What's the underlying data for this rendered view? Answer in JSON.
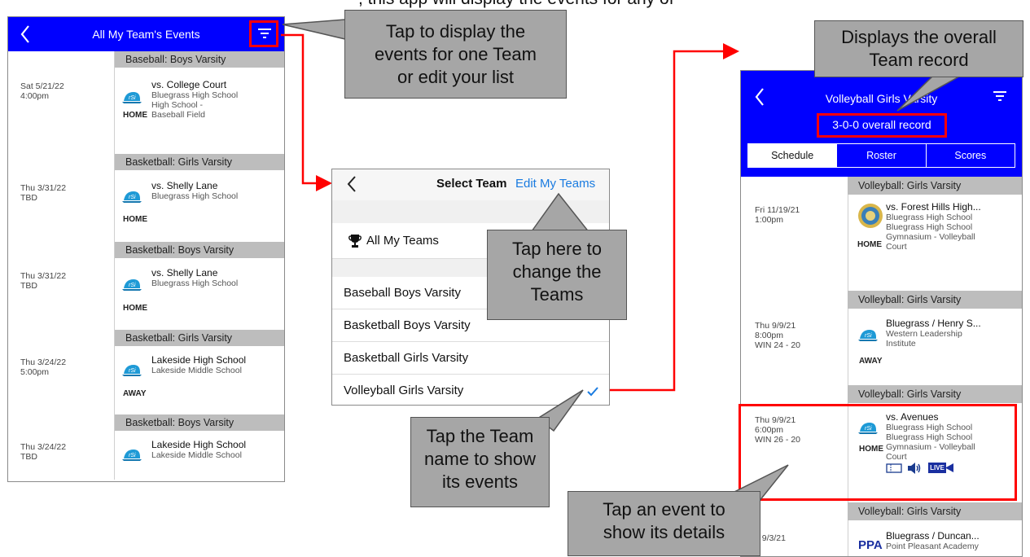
{
  "screen1": {
    "title": "All My Team's Events",
    "events": [
      {
        "section": "Baseball: Boys Varsity",
        "date": "Sat 5/21/22\n4:00pm",
        "opponent": "vs. College Court",
        "details": "Bluegrass High School\nHigh School -\nBaseball Field",
        "location": "HOME"
      },
      {
        "section": "Basketball: Girls Varsity",
        "date": "Thu 3/31/22\nTBD",
        "opponent": "vs. Shelly Lane",
        "details": "Bluegrass High School",
        "location": "HOME"
      },
      {
        "section": "Basketball: Boys Varsity",
        "date": "Thu 3/31/22\nTBD",
        "opponent": "vs. Shelly Lane",
        "details": "Bluegrass High School",
        "location": "HOME"
      },
      {
        "section": "Basketball: Girls Varsity",
        "date": "Thu 3/24/22\n5:00pm",
        "opponent": "Lakeside High School",
        "details": "Lakeside Middle School",
        "location": "AWAY"
      },
      {
        "section": "Basketball: Boys Varsity",
        "date": "Thu 3/24/22\nTBD",
        "opponent": "Lakeside High School",
        "details": "Lakeside Middle School",
        "location": ""
      }
    ]
  },
  "screen2": {
    "title": "Select Team",
    "edit_link": "Edit My Teams",
    "all_teams": "All My Teams",
    "teams": [
      "Baseball Boys Varsity",
      "Basketball Boys Varsity",
      "Basketball Girls Varsity",
      "Volleyball Girls Varsity"
    ],
    "selected_index": 3
  },
  "screen3": {
    "title": "Volleyball Girls Varsity",
    "record": "3-0-0 overall record",
    "tabs": [
      "Schedule",
      "Roster",
      "Scores"
    ],
    "active_tab": 0,
    "events": [
      {
        "section": "Volleyball: Girls Varsity",
        "date": "Fri 11/19/21\n1:00pm",
        "opponent": "vs. Forest Hills High...",
        "details": "Bluegrass High School\nBluegrass High School\nGymnasium - Volleyball\nCourt",
        "location": "HOME"
      },
      {
        "section": "Volleyball: Girls Varsity",
        "date": "Thu 9/9/21\n8:00pm\nWIN 24 - 20",
        "opponent": "Bluegrass / Henry S...",
        "details": "Western Leadership\nInstitute",
        "location": "AWAY"
      },
      {
        "section": "Volleyball: Girls Varsity",
        "date": "Thu 9/9/21\n6:00pm\nWIN 26 - 20",
        "opponent": "vs. Avenues",
        "details": "Bluegrass High School\nBluegrass High School\nGymnasium - Volleyball\nCourt",
        "location": "HOME",
        "live_badge": "LIVE"
      },
      {
        "section": "Volleyball: Girls Varsity",
        "date": "ri 9/3/21",
        "opponent": "Bluegrass / Duncan...",
        "details": "Point Pleasant Academy",
        "location": ""
      }
    ]
  },
  "callouts": {
    "filter": "Tap to display the\nevents for one Team\nor edit your list",
    "record": "Displays the overall\nTeam record",
    "edit": "Tap here to\nchange the\nTeams",
    "team": "Tap the Team\nname to show\nits events",
    "event": "Tap an event to\nshow its details"
  },
  "top_text": ", this app will display the events for any of"
}
